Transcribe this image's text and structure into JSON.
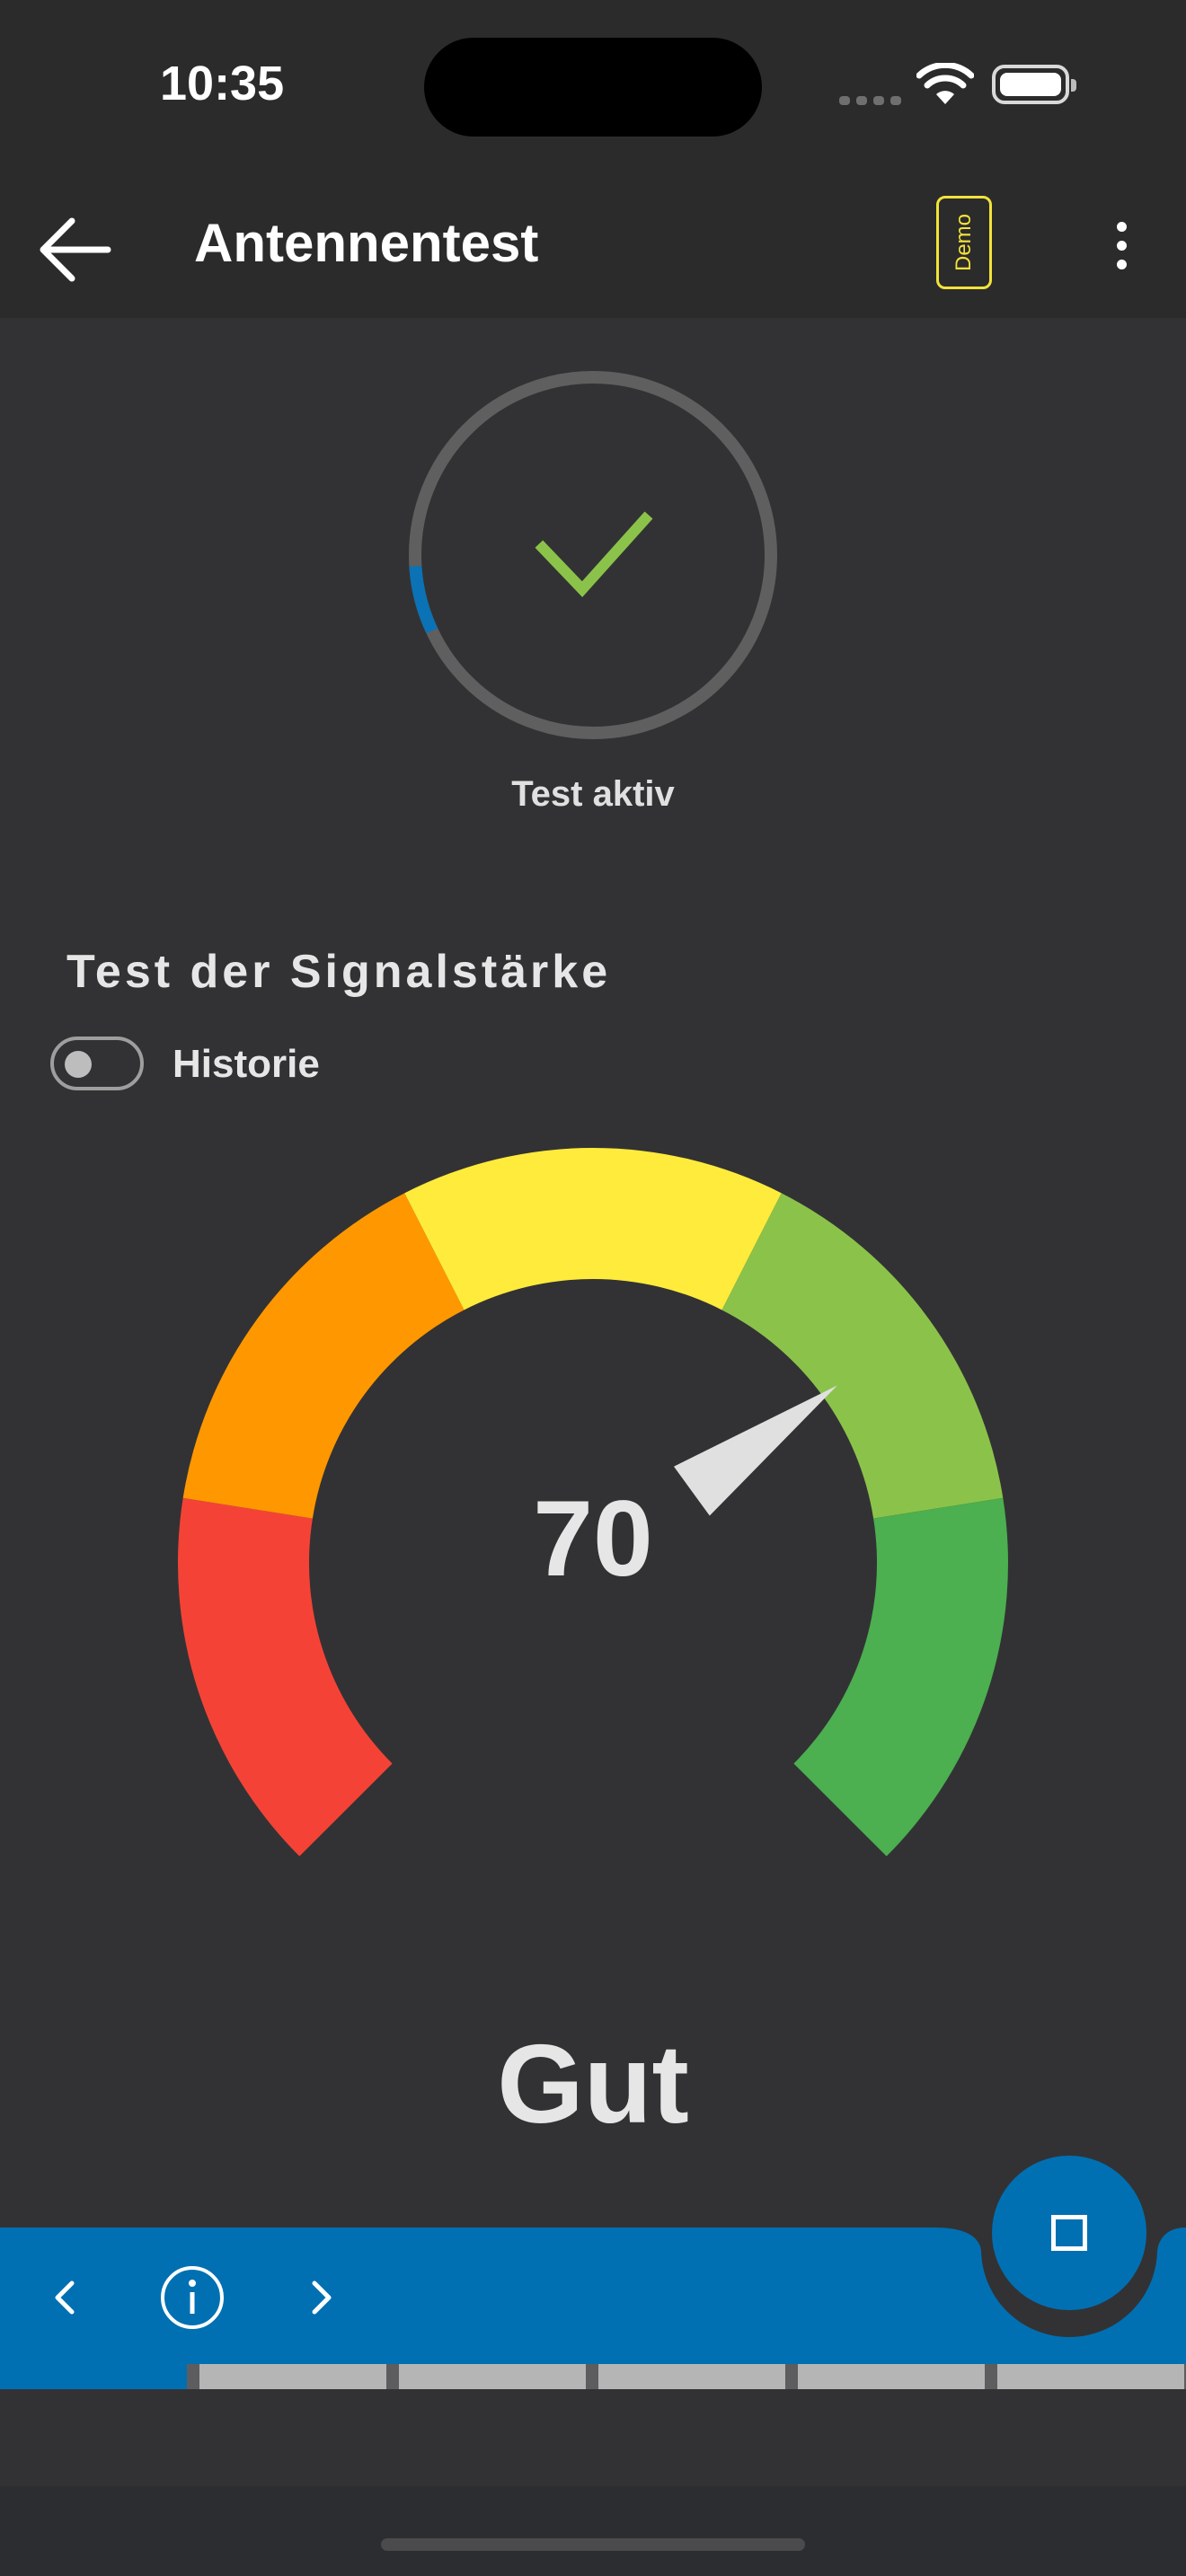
{
  "status_bar": {
    "time": "10:35"
  },
  "app_bar": {
    "title": "Antennentest",
    "demo_label": "Demo"
  },
  "status": {
    "label": "Test aktiv",
    "progress": 0.06,
    "progress_color": "#0a72b5",
    "check_color": "#8bc34a"
  },
  "signal": {
    "section_title": "Test der Signalstärke",
    "history_label": "Historie",
    "history_enabled": false,
    "value": 70,
    "rating": "Gut",
    "gauge_segments": [
      {
        "name": "red",
        "color": "#f44336"
      },
      {
        "name": "orange",
        "color": "#ff9800"
      },
      {
        "name": "yellow",
        "color": "#ffeb3b"
      },
      {
        "name": "light-green",
        "color": "#8bc34a"
      },
      {
        "name": "green",
        "color": "#4caf50"
      }
    ],
    "needle_color": "#e0e0e0"
  },
  "bottom_nav": {
    "prev_icon": "chevron-left-icon",
    "info_icon": "info-icon",
    "next_icon": "chevron-right-icon",
    "stop_icon": "stop-icon",
    "accent": "#0070b3"
  }
}
